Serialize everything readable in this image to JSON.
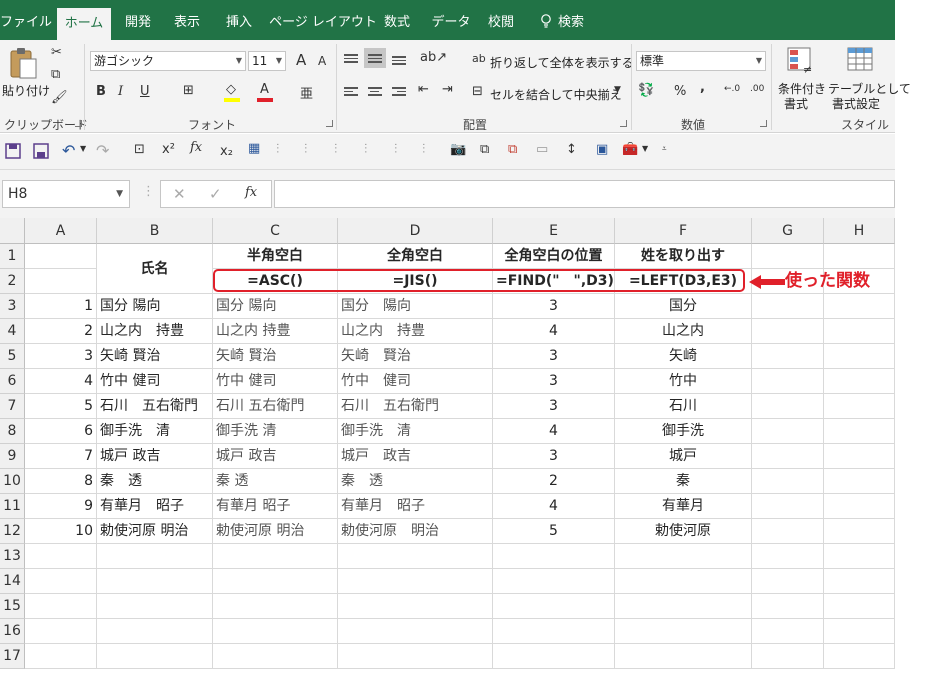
{
  "tabs": [
    {
      "label": "ファイル",
      "active": false
    },
    {
      "label": "ホーム",
      "active": true
    },
    {
      "label": "開発",
      "active": false
    },
    {
      "label": "表示",
      "active": false
    },
    {
      "label": "挿入",
      "active": false
    },
    {
      "label": "ページ レイアウト",
      "active": false
    },
    {
      "label": "数式",
      "active": false
    },
    {
      "label": "データ",
      "active": false
    },
    {
      "label": "校閲",
      "active": false
    }
  ],
  "search_label": "検索",
  "ribbon": {
    "paste_label": "貼り付け",
    "clipboard_label": "クリップボード",
    "font_name": "游ゴシック",
    "font_size": "11",
    "grow_font": "A",
    "shrink_font": "A",
    "bold": "B",
    "italic": "I",
    "underline": "U",
    "font_color_glyph": "A",
    "font_label": "フォント",
    "wrap_text": "折り返して全体を表示する",
    "merge_center": "セルを結合して中央揃え",
    "alignment_label": "配置",
    "number_format": "標準",
    "percent": "%",
    "comma": ",",
    "number_label": "数値",
    "cond_format_line1": "条件付き",
    "cond_format_line2": "書式",
    "table_format_line1": "テーブルとして",
    "table_format_line2": "書式設定",
    "styles_label": "スタイル"
  },
  "namebox": "H8",
  "columns": [
    "A",
    "B",
    "C",
    "D",
    "E",
    "F",
    "G",
    "H"
  ],
  "rows": [
    "1",
    "2",
    "3",
    "4",
    "5",
    "6",
    "7",
    "8",
    "9",
    "10",
    "11",
    "12",
    "13",
    "14",
    "15",
    "16",
    "17"
  ],
  "header": {
    "name_label": "氏名",
    "c1": "半角空白",
    "d1": "全角空白",
    "e1": "全角空白の位置",
    "f1": "姓を取り出す",
    "c2": "=ASC()",
    "d2": "=JIS()",
    "e2": "=FIND(\"　\",D3)",
    "f2": "=LEFT(D3,E3)"
  },
  "data_rows": [
    {
      "a": "1",
      "b": "国分 陽向",
      "c": "国分 陽向",
      "d": "国分　陽向",
      "e": "3",
      "f": "国分"
    },
    {
      "a": "2",
      "b": "山之内　持豊",
      "c": "山之内 持豊",
      "d": "山之内　持豊",
      "e": "4",
      "f": "山之内"
    },
    {
      "a": "3",
      "b": "矢崎 賢治",
      "c": "矢崎 賢治",
      "d": "矢崎　賢治",
      "e": "3",
      "f": "矢崎"
    },
    {
      "a": "4",
      "b": "竹中 健司",
      "c": "竹中 健司",
      "d": "竹中　健司",
      "e": "3",
      "f": "竹中"
    },
    {
      "a": "5",
      "b": "石川　五右衛門",
      "c": "石川 五右衛門",
      "d": "石川　五右衛門",
      "e": "3",
      "f": "石川"
    },
    {
      "a": "6",
      "b": "御手洗　清",
      "c": "御手洗 清",
      "d": "御手洗　清",
      "e": "4",
      "f": "御手洗"
    },
    {
      "a": "7",
      "b": "城戸 政吉",
      "c": "城戸 政吉",
      "d": "城戸　政吉",
      "e": "3",
      "f": "城戸"
    },
    {
      "a": "8",
      "b": "秦　透",
      "c": "秦 透",
      "d": "秦　透",
      "e": "2",
      "f": "秦"
    },
    {
      "a": "9",
      "b": "有華月　昭子",
      "c": "有華月 昭子",
      "d": "有華月　昭子",
      "e": "4",
      "f": "有華月"
    },
    {
      "a": "10",
      "b": "勅使河原 明治",
      "c": "勅使河原 明治",
      "d": "勅使河原　明治",
      "e": "5",
      "f": "勅使河原"
    }
  ],
  "annotation": "使った関数",
  "colors": {
    "excel_green": "#217346",
    "annotation_red": "#e0202a"
  }
}
